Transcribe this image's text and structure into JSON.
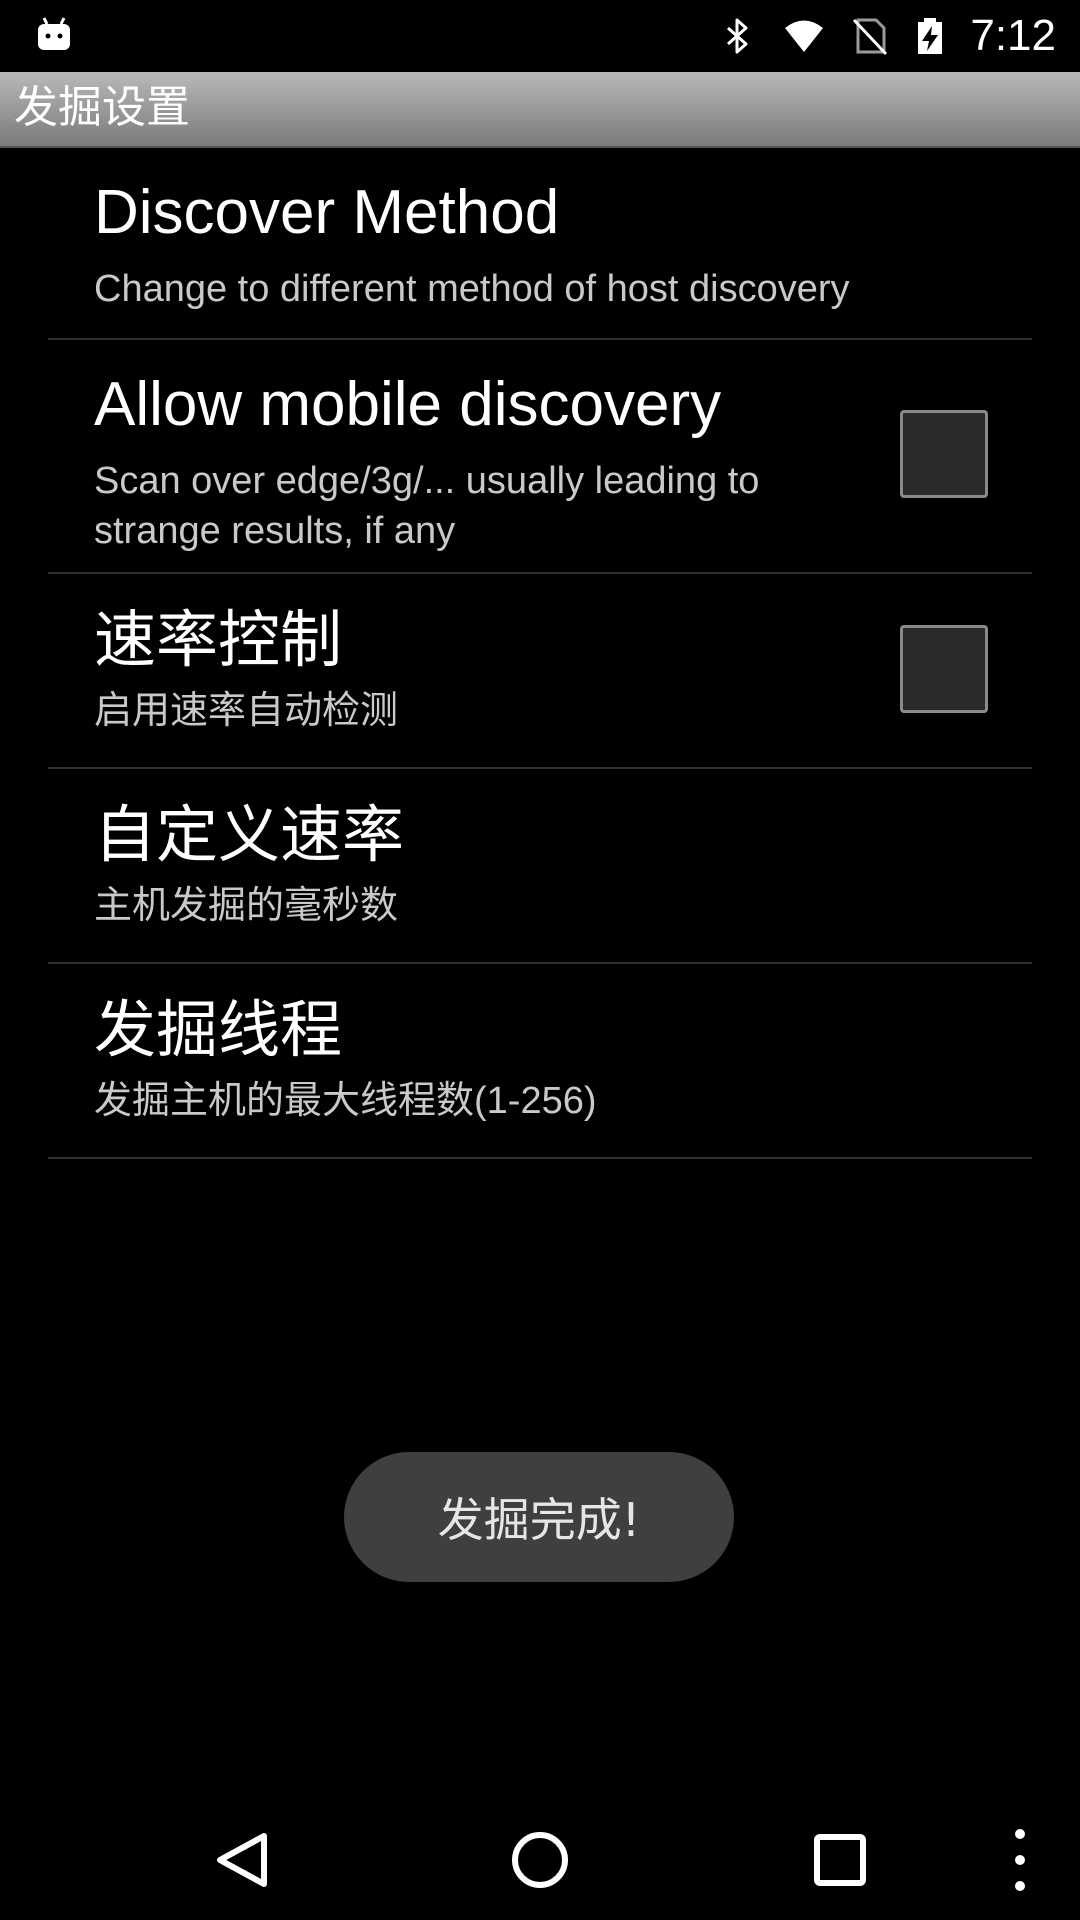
{
  "status_bar": {
    "time": "7:12",
    "icons": [
      "android-debug-icon",
      "bluetooth-icon",
      "wifi-icon",
      "no-sim-icon",
      "battery-charging-icon"
    ]
  },
  "app_bar": {
    "title": "发掘设置"
  },
  "preferences": [
    {
      "title": "Discover Method",
      "summary": "Change to different method of host discovery",
      "has_checkbox": false
    },
    {
      "title": "Allow mobile discovery",
      "summary_lines": [
        "Scan over edge/3g/... usually leading to",
        "strange results, if any"
      ],
      "has_checkbox": true,
      "checked": false
    },
    {
      "title": "速率控制",
      "summary": "启用速率自动检测",
      "has_checkbox": true,
      "checked": false
    },
    {
      "title": "自定义速率",
      "summary": "主机发掘的毫秒数",
      "has_checkbox": false
    },
    {
      "title": "发掘线程",
      "summary": "发掘主机的最大线程数(1-256)",
      "has_checkbox": false
    }
  ],
  "toast": {
    "text": "发掘完成!"
  },
  "nav_bar": {
    "buttons": [
      "back-icon",
      "home-icon",
      "recents-icon",
      "overflow-menu-icon"
    ]
  },
  "colors": {
    "background": "#000000",
    "title_bar_top": "#b9b9b9",
    "title_bar_bottom": "#7a7a7a",
    "summary_text": "#c9c9c9",
    "divider": "#2f2f2f",
    "toast_bg": "#3f3f3f"
  }
}
